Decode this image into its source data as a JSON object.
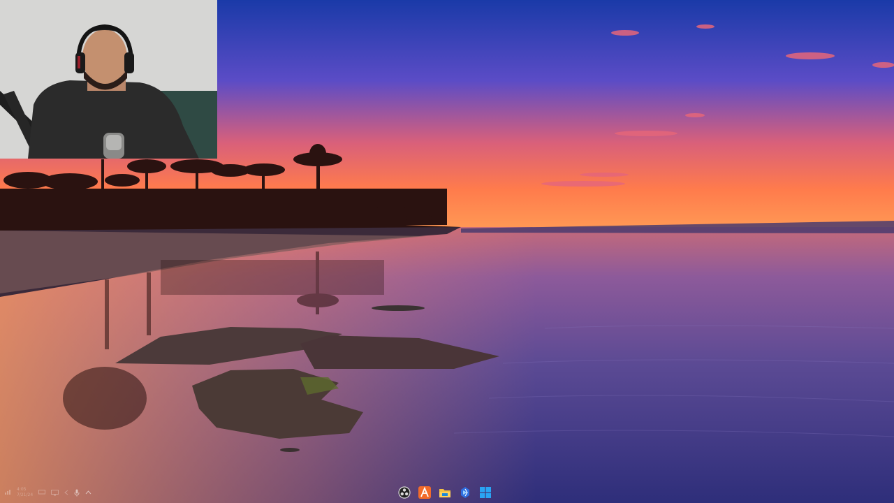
{
  "desktop": {
    "wallpaper": "sunset-lake-palms",
    "colors": {
      "sky_top": "#1b3aa6",
      "sky_mid": "#6a4fc8",
      "sky_horizon": "#ff7a4a",
      "water": "#5a3f8c"
    }
  },
  "webcam": {
    "label": "presenter-webcam"
  },
  "tray": {
    "clock_time": "4:05",
    "clock_date": "7/21/24"
  },
  "taskbar": {
    "apps": [
      {
        "name": "obs-icon"
      },
      {
        "name": "appwrite-icon"
      },
      {
        "name": "file-explorer-icon"
      },
      {
        "name": "visual-studio-icon"
      },
      {
        "name": "start-menu-icon"
      }
    ]
  }
}
